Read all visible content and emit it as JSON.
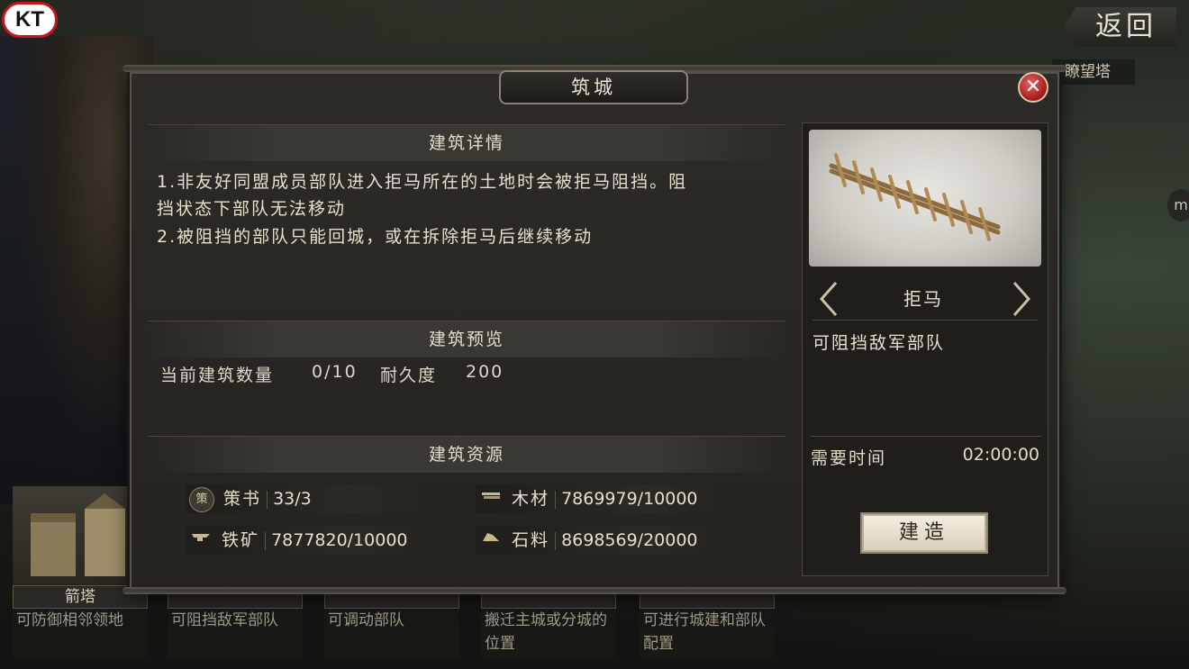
{
  "background": {
    "logo": "KT",
    "back_button": "返回",
    "tower_tag": "瞭望塔",
    "side_icon": "m"
  },
  "cards": [
    {
      "name": "箭塔",
      "desc": "可防御相邻领地"
    },
    {
      "name": "",
      "desc": "可阻挡敌军部队"
    },
    {
      "name": "",
      "desc": "可调动部队"
    },
    {
      "name": "",
      "desc": "搬迁主城或分城的位置"
    },
    {
      "name": "",
      "desc": "可进行城建和部队配置"
    }
  ],
  "dialog": {
    "title": "筑城",
    "close_icon": "close-icon",
    "details": {
      "heading": "建筑详情",
      "lines": [
        "1.非友好同盟成员部队进入拒马所在的土地时会被拒马阻挡。阻",
        "挡状态下部队无法移动",
        "2.被阻挡的部队只能回城，或在拆除拒马后继续移动"
      ]
    },
    "preview": {
      "heading": "建筑预览",
      "count_label": "当前建筑数量",
      "count_value": "0/10",
      "durability_label": "耐久度",
      "durability_value": "200"
    },
    "resources": {
      "heading": "建筑资源",
      "items": [
        {
          "icon": "strategy-book-icon",
          "glyph": "策",
          "name": "策书",
          "value": "33/3"
        },
        {
          "icon": "wood-icon",
          "glyph": "",
          "name": "木材",
          "value": "7869979/10000"
        },
        {
          "icon": "iron-icon",
          "glyph": "",
          "name": "铁矿",
          "value": "7877820/10000"
        },
        {
          "icon": "stone-icon",
          "glyph": "",
          "name": "石料",
          "value": "8698569/20000"
        }
      ]
    },
    "building": {
      "name": "拒马",
      "short_desc": "可阻挡敌军部队",
      "time_label": "需要时间",
      "time_value": "02:00:00",
      "build_button": "建造"
    }
  }
}
